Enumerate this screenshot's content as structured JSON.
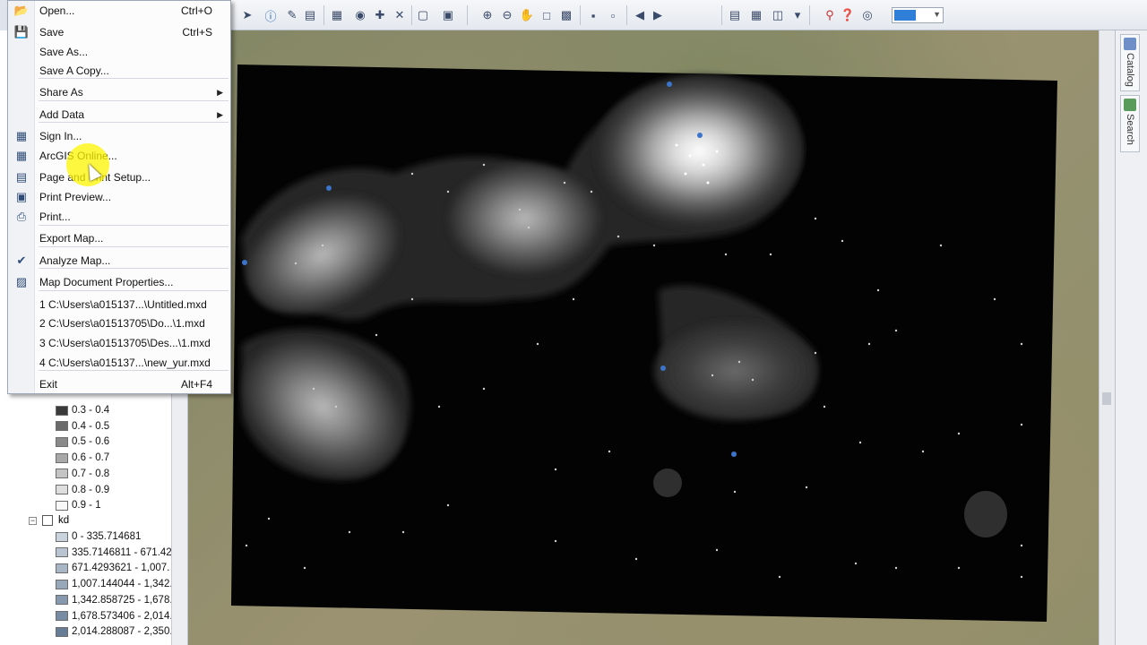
{
  "file_menu": {
    "items": [
      {
        "label": "Open...",
        "shortcut": "Ctrl+O",
        "icon": "folder-open-icon"
      },
      {
        "label": "Save",
        "shortcut": "Ctrl+S",
        "icon": "floppy-save-icon"
      },
      {
        "label": "Save As...",
        "shortcut": "",
        "icon": ""
      },
      {
        "label": "Save A Copy...",
        "shortcut": "",
        "icon": ""
      },
      {
        "label": "Share As",
        "shortcut": "",
        "icon": "",
        "submenu": true
      },
      {
        "label": "Add Data",
        "shortcut": "",
        "icon": "",
        "submenu": true
      },
      {
        "label": "Sign In...",
        "shortcut": "",
        "icon": "sign-in-icon"
      },
      {
        "label": "ArcGIS Online...",
        "shortcut": "",
        "icon": "arcgis-online-icon"
      },
      {
        "label": "Page and Print Setup...",
        "shortcut": "",
        "icon": "page-setup-icon"
      },
      {
        "label": "Print Preview...",
        "shortcut": "",
        "icon": "print-preview-icon"
      },
      {
        "label": "Print...",
        "shortcut": "",
        "icon": "printer-icon"
      },
      {
        "label": "Export Map...",
        "shortcut": "",
        "icon": ""
      },
      {
        "label": "Analyze Map...",
        "shortcut": "",
        "icon": "analyze-map-icon"
      },
      {
        "label": "Map Document Properties...",
        "shortcut": "",
        "icon": "document-properties-icon"
      },
      {
        "label": "1 C:\\Users\\a015137...\\Untitled.mxd",
        "shortcut": "",
        "icon": ""
      },
      {
        "label": "2 C:\\Users\\a01513705\\Do...\\1.mxd",
        "shortcut": "",
        "icon": ""
      },
      {
        "label": "3 C:\\Users\\a01513705\\Des...\\1.mxd",
        "shortcut": "",
        "icon": ""
      },
      {
        "label": "4 C:\\Users\\a015137...\\new_yur.mxd",
        "shortcut": "",
        "icon": ""
      },
      {
        "label": "Exit",
        "shortcut": "Alt+F4",
        "icon": ""
      }
    ]
  },
  "toc": {
    "density_classes": [
      "0.3 - 0.4",
      "0.4 - 0.5",
      "0.5 - 0.6",
      "0.6 - 0.7",
      "0.7 - 0.8",
      "0.8 - 0.9",
      "0.9 - 1"
    ],
    "density_colors": [
      "#3a3a3a",
      "#6a6a6a",
      "#8a8a8a",
      "#a8a8a8",
      "#c4c4c4",
      "#dedede",
      "#f8f8f8"
    ],
    "kd_layer_name": "kd",
    "kd_classes": [
      "0 - 335.714681",
      "335.7146811 - 671.42",
      "671.4293621 - 1,007.",
      "1,007.144044 - 1,342.",
      "1,342.858725 - 1,678.",
      "1,678.573406 - 2,014.",
      "2,014.288087 - 2,350."
    ],
    "kd_colors": [
      "#c9d3de",
      "#b8c4d2",
      "#a8b6c6",
      "#98a8bb",
      "#8799af",
      "#778ba3",
      "#667c97"
    ]
  },
  "side_tabs": {
    "catalog": "Catalog",
    "search": "Search"
  },
  "colors": {
    "menu_bg": "#fcfcfd",
    "highlight": "#fff500",
    "point_blue": "#3b74c9"
  }
}
